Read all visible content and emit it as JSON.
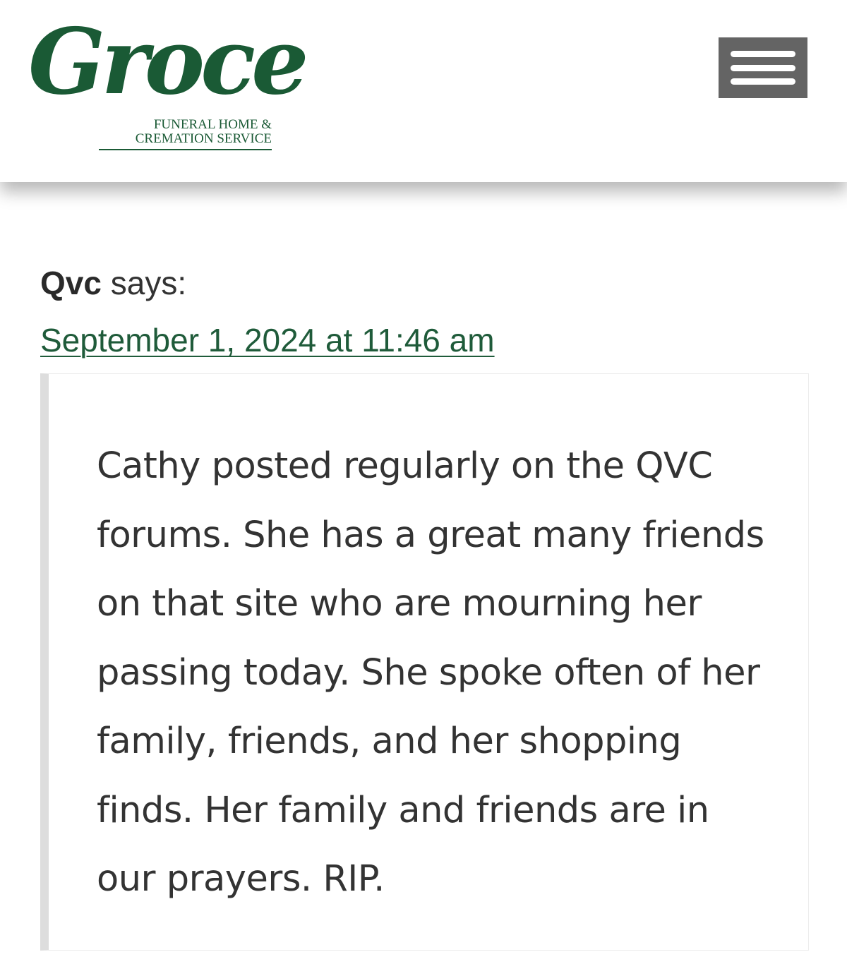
{
  "header": {
    "logo": {
      "script_text": "Groce",
      "line1": "FUNERAL HOME &",
      "line2": "CREMATION SERVICE",
      "color": "#1a5a35"
    },
    "menu_icon": "hamburger-menu-icon",
    "menu_color": "#646464"
  },
  "comment": {
    "author": "Qvc",
    "says": "says:",
    "date": "September 1, 2024 at 11:46 am",
    "link_color": "#1f5b3a",
    "text": "Cathy posted regularly on the QVC forums. She has a great many friends on that site who are mourning her passing today. She spoke often of her family, friends, and her shopping finds. Her family and friends are in our prayers. RIP."
  }
}
